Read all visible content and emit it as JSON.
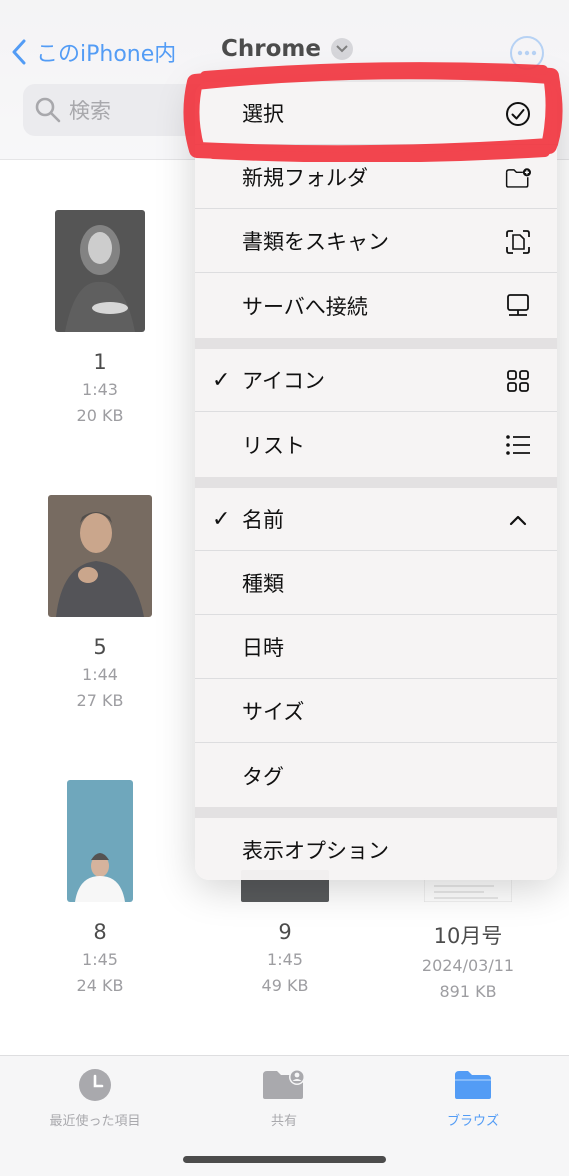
{
  "header": {
    "back_label": "このiPhone内",
    "folder_title": "Chrome",
    "search_placeholder": "検索"
  },
  "files": [
    {
      "name": "1",
      "time": "1:43",
      "size": "20 KB"
    },
    {
      "name": "5",
      "time": "1:44",
      "size": "27 KB"
    },
    {
      "name": "8",
      "time": "1:45",
      "size": "24 KB"
    },
    {
      "name": "9",
      "time": "1:45",
      "size": "49 KB"
    },
    {
      "name": "10月号",
      "time": "2024/03/11",
      "size": "891 KB"
    }
  ],
  "menu": {
    "select": "選択",
    "new_folder": "新規フォルダ",
    "scan": "書類をスキャン",
    "connect": "サーバへ接続",
    "icons": "アイコン",
    "list": "リスト",
    "sort_name": "名前",
    "sort_kind": "種類",
    "sort_date": "日時",
    "sort_size": "サイズ",
    "sort_tag": "タグ",
    "view_options": "表示オプション",
    "check_mark": "✓"
  },
  "tabbar": {
    "recents": "最近使った項目",
    "shared": "共有",
    "browse": "ブラウズ"
  },
  "colors": {
    "accent": "#1a7bf2",
    "annotation_red": "#f2333d"
  }
}
